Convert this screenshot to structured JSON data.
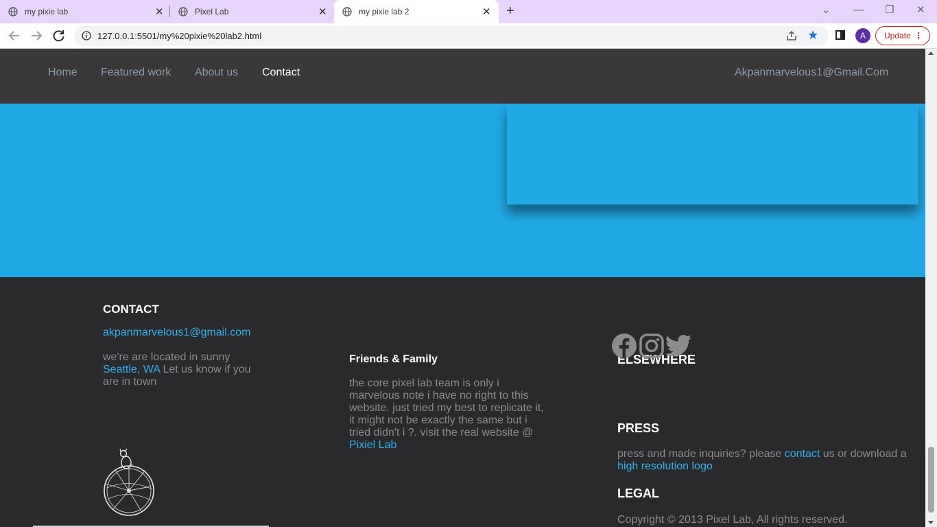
{
  "browser": {
    "tabs": [
      {
        "title": "my pixie lab"
      },
      {
        "title": "Pixel Lab"
      },
      {
        "title": "my pixie lab 2",
        "active": true
      }
    ],
    "url": "127.0.0.1:5501/my%20pixie%20lab2.html",
    "profile_initial": "A",
    "update_label": "Update"
  },
  "site_nav": {
    "items": [
      "Home",
      "Featured work",
      "About us",
      "Contact"
    ],
    "active": "Contact",
    "email": "Akpanmarvelous1@Gmail.Com"
  },
  "footer": {
    "contact": {
      "heading": "CONTACT",
      "email": "akpanmarvelous1@gmail.com",
      "location_prefix": "we're are located in sunny ",
      "location_link": "Seattle, WA",
      "location_suffix": " Let us know if you are in town"
    },
    "friends": {
      "heading": "Friends & Family",
      "text": "the core pixel lab team is only i marvelous note i have no right to this website. just tried my best to replicate it, it might not be exactly the same but i tried didn't i ?. visit the real website @ ",
      "link": "Pixiel Lab"
    },
    "elsewhere": {
      "heading": "ELSEWHERE",
      "icons": [
        "facebook-icon",
        "instagram-icon",
        "twitter-icon"
      ]
    },
    "press": {
      "heading": "PRESS",
      "text_a": "press and made inquiries? please ",
      "link_contact": "contact",
      "text_b": " us or download a ",
      "link_logo": "high resolution logo"
    },
    "legal": {
      "heading": "LEGAL",
      "copyright": "Copyright © 2013 Pixel Lab, All rights reserved."
    }
  },
  "colors": {
    "hero_blue": "#21a9e6",
    "link_blue": "#2eb2f0",
    "footer_bg": "#2a2a2c",
    "nav_bg": "#3a3838"
  }
}
